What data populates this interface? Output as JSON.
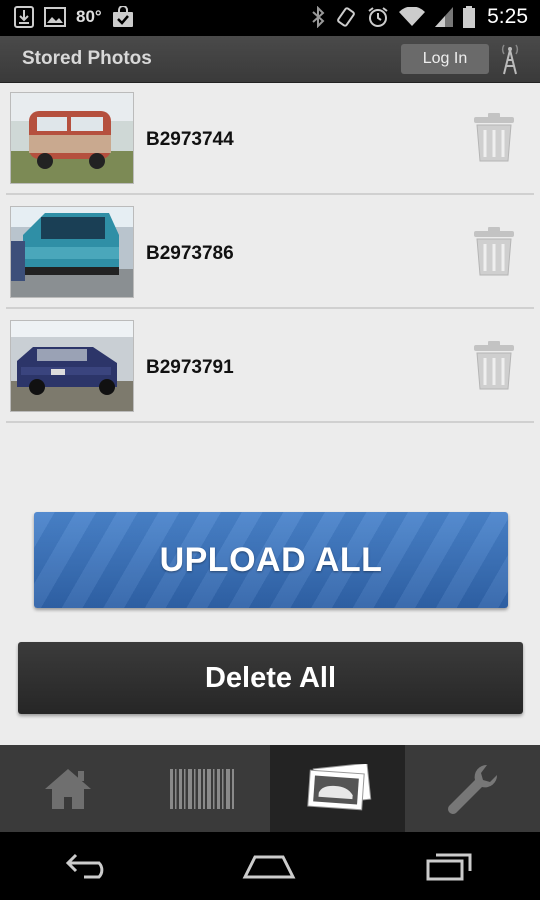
{
  "status_bar": {
    "temperature": "80°",
    "time": "5:25",
    "icons": [
      "download-icon",
      "image-icon",
      "shopping-bag-icon",
      "bluetooth-icon",
      "rotate-icon",
      "alarm-icon",
      "wifi-icon",
      "cell-signal-icon",
      "battery-icon"
    ]
  },
  "action_bar": {
    "title": "Stored Photos",
    "login_label": "Log In",
    "icon": "signal-tower-icon"
  },
  "photos": [
    {
      "code": "B2973744",
      "thumb_color": "#b5503e"
    },
    {
      "code": "B2973786",
      "thumb_color": "#2f8fa6"
    },
    {
      "code": "B2973791",
      "thumb_color": "#2c3569"
    }
  ],
  "buttons": {
    "upload_all": "UPLOAD ALL",
    "delete_all": "Delete All"
  },
  "tabs": [
    {
      "icon": "home-icon",
      "active": false
    },
    {
      "icon": "barcode-icon",
      "active": false
    },
    {
      "icon": "photos-icon",
      "active": true
    },
    {
      "icon": "wrench-icon",
      "active": false
    }
  ],
  "colors": {
    "upload_blue": "#3b72bb",
    "delete_dark": "#2e2e2e",
    "action_bar": "#414141"
  }
}
